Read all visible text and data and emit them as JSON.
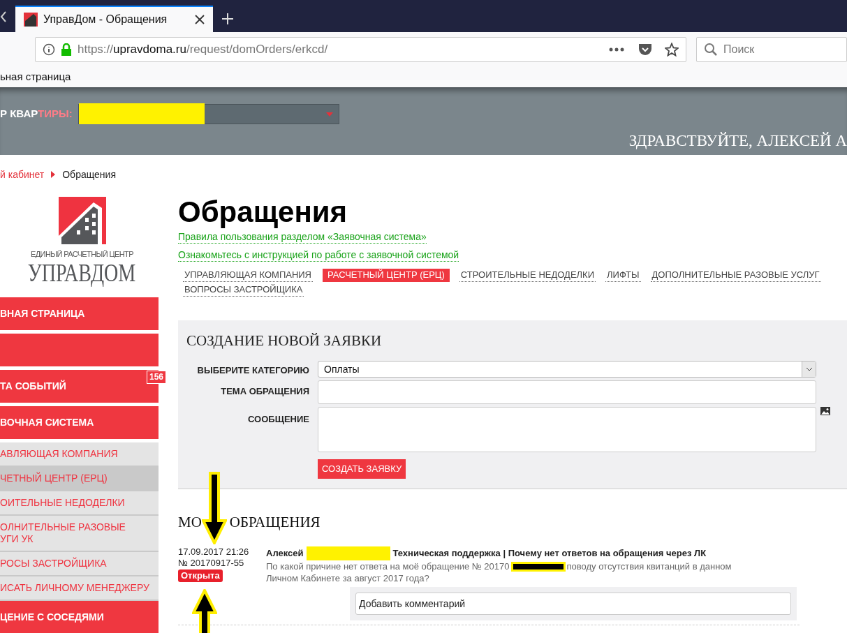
{
  "browser": {
    "tab_title": "УправДом - Обращения",
    "url_prefix": "https://",
    "url_host": "upravdoma.ru",
    "url_path": "/request/domOrders/erkcd/",
    "search_placeholder": "Поиск",
    "bookmark": "ьная страница"
  },
  "header": {
    "apartment_label": "Р КВАР",
    "apartment_label_accent": "ТИРЫ:",
    "greeting": "ЗДРАВСТВУЙТЕ, АЛЕКСЕЙ А"
  },
  "breadcrumbs": [
    {
      "label": "й кабинет",
      "link": true
    },
    {
      "label": "Обращения",
      "link": false
    }
  ],
  "logo": {
    "subtitle": "ЕДИНЫЙ РАСЧЕТНЫЙ ЦЕНТР",
    "name": "УПРАВДОМ"
  },
  "sidebar": {
    "items": [
      {
        "kind": "main",
        "label": "ВНАЯ СТРАНИЦА",
        "selected": false
      },
      {
        "kind": "main",
        "selected": false
      },
      {
        "kind": "main",
        "label": "ТА СОБЫТИЙ",
        "badge": "156",
        "selected": false
      },
      {
        "kind": "main",
        "label": "ВОЧНАЯ СИСТЕМА",
        "selected": false
      },
      {
        "kind": "sub",
        "label": "АВЛЯЮЩАЯ КОМПАНИЯ",
        "selected": false
      },
      {
        "kind": "sub",
        "label": "ЧЕТНЫЙ ЦЕНТР (ЕРЦ)",
        "selected": true
      },
      {
        "kind": "sub",
        "label": "ОИТЕЛЬНЫЕ НЕДОДЕЛКИ",
        "selected": false
      },
      {
        "kind": "sub",
        "label": "ОЛНИТЕЛЬНЫЕ РАЗОВЫЕ\nУГИ УК",
        "selected": false
      },
      {
        "kind": "sub",
        "label": "РОСЫ ЗАСТРОЙЩИКА",
        "selected": false
      },
      {
        "kind": "sub",
        "label": "ИСАТЬ ЛИЧНОМУ МЕНЕДЖЕРУ",
        "selected": false
      },
      {
        "kind": "main",
        "label": "ЦЕНИЕ С СОСЕДЯМИ",
        "selected": false
      }
    ]
  },
  "page": {
    "title": "Обращения",
    "links": [
      "Правила пользования разделом «Заявочная система»",
      "Ознакомьтесь с инструкцией по работе с заявочной системой"
    ],
    "tabs": [
      {
        "label": "УПРАВЛЯЮЩАЯ КОМПАНИЯ",
        "selected": false
      },
      {
        "label": "РАСЧЕТНЫЙ ЦЕНТР (ЕРЦ)",
        "selected": true
      },
      {
        "label": "СТРОИТЕЛЬНЫЕ НЕДОДЕЛКИ",
        "selected": false
      },
      {
        "label": "ЛИФТЫ",
        "selected": false
      },
      {
        "label": "ДОПОЛНИТЕЛЬНЫЕ РАЗОВЫЕ УСЛУГ",
        "selected": false
      },
      {
        "label": "ВОПРОСЫ ЗАСТРОЙЩИКА",
        "selected": false
      }
    ]
  },
  "new_request": {
    "title": "СОЗДАНИЕ НОВОЙ ЗАЯВКИ",
    "category_label": "ВЫБЕРИТЕ КАТЕГОРИЮ",
    "category_value": "Оплаты",
    "subject_label": "ТЕМА ОБРАЩЕНИЯ",
    "message_label": "СООБЩЕНИЕ",
    "submit": "СОЗДАТЬ ЗАЯВКУ"
  },
  "my_requests": {
    "title_parts": [
      "МО",
      "ОБРАЩЕНИЯ"
    ],
    "items": [
      {
        "date": "17.09.2017 21:26",
        "number": "№ 20170917-55",
        "status": "Открыта",
        "author": "Алексей",
        "subject": "Техническая поддержка | Почему нет ответов на обращения через ЛК",
        "message_parts": [
          "По какой причине нет ответа на моё обращение № 20170",
          "поводу отсутствия квитанций в данном",
          "Личном Кабинете за август 2017 года?"
        ],
        "comment_placeholder": "Добавить комментарий"
      }
    ]
  }
}
